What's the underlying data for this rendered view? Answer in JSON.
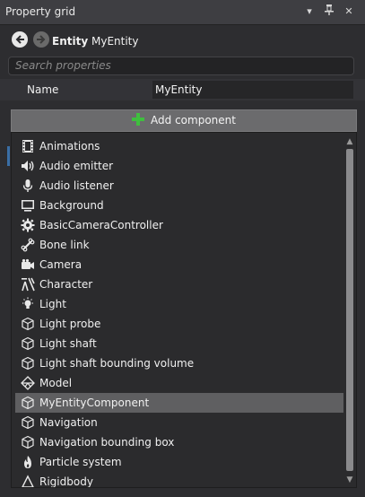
{
  "window": {
    "title": "Property grid",
    "controls": [
      "▾",
      "⊥",
      "✕"
    ]
  },
  "nav": {
    "entity_kind": "Entity",
    "entity_name": "MyEntity"
  },
  "search": {
    "placeholder": "Search properties"
  },
  "properties": {
    "name_label": "Name",
    "name_value": "MyEntity"
  },
  "add_component": {
    "label": "Add component"
  },
  "component_menu": {
    "items": [
      {
        "label": "Animations",
        "icon": "film-icon"
      },
      {
        "label": "Audio emitter",
        "icon": "speaker-icon"
      },
      {
        "label": "Audio listener",
        "icon": "microphone-icon"
      },
      {
        "label": "Background",
        "icon": "monitor-icon"
      },
      {
        "label": "BasicCameraController",
        "icon": "gear-icon"
      },
      {
        "label": "Bone link",
        "icon": "bone-icon"
      },
      {
        "label": "Camera",
        "icon": "camera-icon"
      },
      {
        "label": "Character",
        "icon": "character-icon"
      },
      {
        "label": "Light",
        "icon": "lightbulb-icon"
      },
      {
        "label": "Light probe",
        "icon": "cube-icon"
      },
      {
        "label": "Light shaft",
        "icon": "cube-icon"
      },
      {
        "label": "Light shaft bounding volume",
        "icon": "cube-icon"
      },
      {
        "label": "Model",
        "icon": "model-icon"
      },
      {
        "label": "MyEntityComponent",
        "icon": "cube-icon"
      },
      {
        "label": "Navigation",
        "icon": "cube-icon"
      },
      {
        "label": "Navigation bounding box",
        "icon": "cube-icon"
      },
      {
        "label": "Particle system",
        "icon": "flame-icon"
      },
      {
        "label": "Rigidbody",
        "icon": "rigidbody-icon"
      }
    ],
    "selected_index": 13
  },
  "colors": {
    "background": "#2d2d30",
    "selected": "#5f5f61",
    "button": "#6b6b6d",
    "accent_green": "#3fbf3f"
  }
}
